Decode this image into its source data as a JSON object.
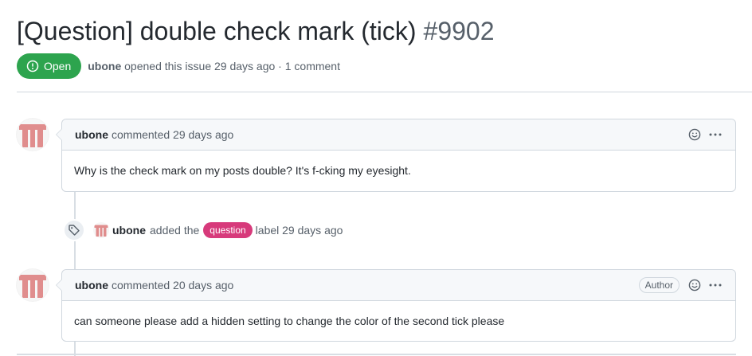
{
  "issue": {
    "title": "[Question] double check mark (tick)",
    "number": "#9902",
    "state": "Open",
    "author": "ubone",
    "opened_text": "opened this issue 29 days ago",
    "separator": "·",
    "comments_count": "1 comment"
  },
  "comments": [
    {
      "author": "ubone",
      "action": "commented 29 days ago",
      "body": "Why is the check mark on my posts double? It's f-cking my eyesight."
    },
    {
      "author": "ubone",
      "action": "commented 20 days ago",
      "badge": "Author",
      "body": "can someone please add a hidden setting to change the color of the second tick please"
    }
  ],
  "event": {
    "author": "ubone",
    "text_before": "added the",
    "label": "question",
    "text_after": "label 29 days ago"
  },
  "colors": {
    "open_badge": "#2da44e",
    "label_question": "#d73a7b",
    "avatar_pink": "#e08d8d"
  },
  "icons": {
    "state": "issue-opened-icon",
    "reaction": "smiley-icon",
    "more": "kebab-horizontal-icon",
    "event": "tag-icon"
  }
}
